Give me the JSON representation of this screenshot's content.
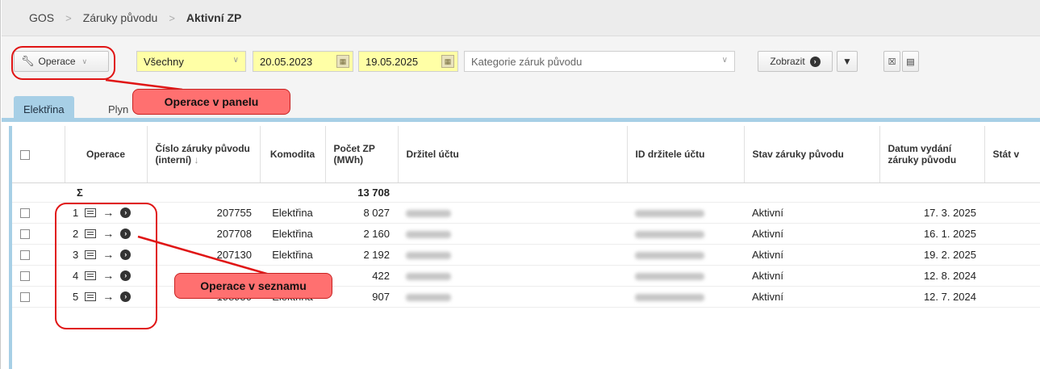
{
  "breadcrumb": {
    "items": [
      "GOS",
      "Záruky původu"
    ],
    "current": "Aktivní ZP"
  },
  "toolbar": {
    "operations_label": "Operace",
    "filter_value": "Všechny",
    "date_from": "20.05.2023",
    "date_to": "19.05.2025",
    "category_placeholder": "Kategorie záruk původu",
    "show_label": "Zobrazit"
  },
  "tabs": [
    "Elektřina",
    "Plyn"
  ],
  "table": {
    "headers": {
      "operations": "Operace",
      "number": "Číslo záruky původu (interní)",
      "commodity": "Komodita",
      "count": "Počet ZP (MWh)",
      "holder": "Držitel účtu",
      "holder_id": "ID držitele účtu",
      "state": "Stav záruky původu",
      "issued": "Datum vydání záruky původu",
      "country": "Stát v"
    },
    "sum_symbol": "Σ",
    "sum_value": "13 708",
    "rows": [
      {
        "n": "1",
        "number": "207755",
        "commodity": "Elektřina",
        "count": "8 027",
        "state": "Aktivní",
        "issued": "17. 3. 2025"
      },
      {
        "n": "2",
        "number": "207708",
        "commodity": "Elektřina",
        "count": "2 160",
        "state": "Aktivní",
        "issued": "16. 1. 2025"
      },
      {
        "n": "3",
        "number": "207130",
        "commodity": "Elektřina",
        "count": "2 192",
        "state": "Aktivní",
        "issued": "19. 2. 2025"
      },
      {
        "n": "4",
        "number": "",
        "commodity": "",
        "count": "422",
        "state": "Aktivní",
        "issued": "12. 8. 2024"
      },
      {
        "n": "5",
        "number": "198950",
        "commodity": "Elektřina",
        "count": "907",
        "state": "Aktivní",
        "issued": "12. 7. 2024"
      }
    ]
  },
  "annotations": {
    "panel": "Operace v panelu",
    "list": "Operace v seznamu"
  },
  "colors": {
    "accent": "#a7cfe6",
    "highlight": "#ffffa6",
    "callout": "#ff7070",
    "ring": "#e01515"
  }
}
